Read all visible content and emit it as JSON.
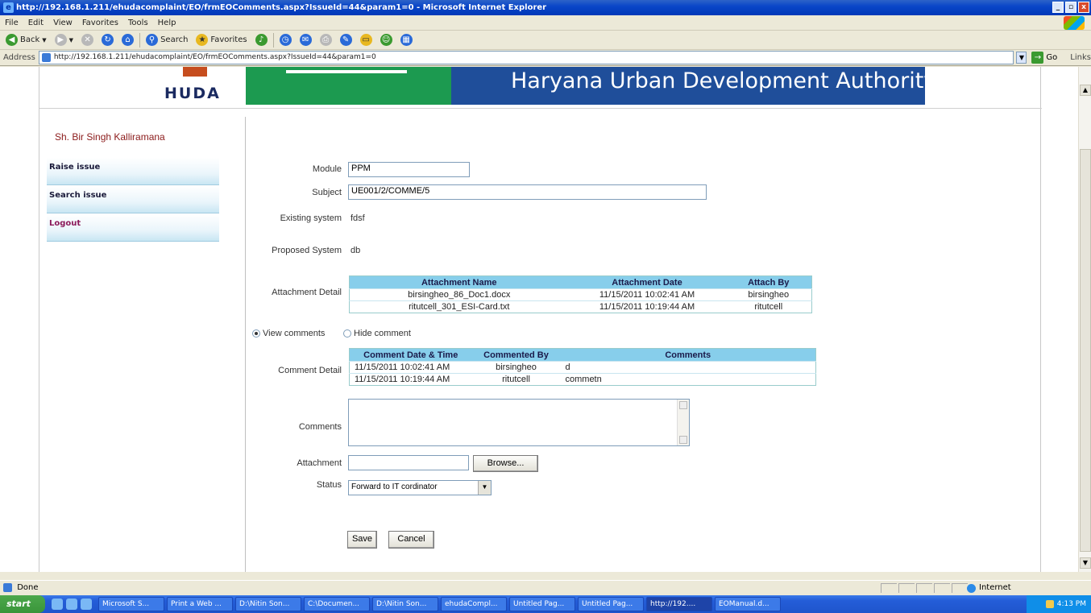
{
  "window": {
    "title": "http://192.168.1.211/ehudacomplaint/EO/frmEOComments.aspx?IssueId=44&param1=0 - Microsoft Internet Explorer",
    "controls": [
      "_",
      "▫",
      "x"
    ]
  },
  "menu": [
    "File",
    "Edit",
    "View",
    "Favorites",
    "Tools",
    "Help"
  ],
  "toolbar": {
    "back_label": "Back",
    "search_label": "Search",
    "favorites_label": "Favorites"
  },
  "addressbar": {
    "label": "Address",
    "url": "http://192.168.1.211/ehudacomplaint/EO/frmEOComments.aspx?IssueId=44&param1=0",
    "go_label": "Go",
    "links_label": "Links"
  },
  "banner": {
    "logo_text": "HUDA",
    "org_name": "Haryana Urban Development Authority"
  },
  "sidebar": {
    "user_name": "Sh. Bir Singh Kalliramana",
    "items": [
      {
        "label": "Raise issue"
      },
      {
        "label": "Search issue"
      },
      {
        "label": "Logout"
      }
    ]
  },
  "form": {
    "module_label": "Module",
    "module_value": "PPM",
    "subject_label": "Subject",
    "subject_value": "UE001/2/COMME/5",
    "existing_label": "Existing system",
    "existing_value": "fdsf",
    "proposed_label": "Proposed System",
    "proposed_value": "db",
    "attachment_detail_label": "Attachment Detail",
    "view_comments_label": "View comments",
    "hide_comment_label": "Hide comment",
    "comment_detail_label": "Comment Detail",
    "comments_label": "Comments",
    "comments_value": "",
    "attachment_label": "Attachment",
    "attachment_value": "",
    "browse_label": "Browse...",
    "status_label": "Status",
    "status_value": "Forward to IT cordinator",
    "save_label": "Save",
    "cancel_label": "Cancel"
  },
  "attachments": {
    "headers": [
      "Attachment Name",
      "Attachment Date",
      "Attach By"
    ],
    "rows": [
      [
        "birsingheo_86_Doc1.docx",
        "11/15/2011 10:02:41 AM",
        "birsingheo"
      ],
      [
        "ritutcell_301_ESI-Card.txt",
        "11/15/2011 10:19:44 AM",
        "ritutcell"
      ]
    ]
  },
  "comments": {
    "headers": [
      "Comment Date & Time",
      "Commented By",
      "Comments"
    ],
    "rows": [
      [
        "11/15/2011 10:02:41 AM",
        "birsingheo",
        "d"
      ],
      [
        "11/15/2011 10:19:44 AM",
        "ritutcell",
        "commetn"
      ]
    ]
  },
  "statusbar": {
    "status_text": "Done",
    "zone": "Internet"
  },
  "taskbar": {
    "start_label": "start",
    "tasks": [
      "Microsoft S...",
      "Print a Web ...",
      "D:\\Nitin Son...",
      "C:\\Documen...",
      "D:\\Nitin Son...",
      "ehudaCompl...",
      "Untitled Pag...",
      "Untitled Pag...",
      "http://192....",
      "EOManual.d..."
    ],
    "clock": "4:13 PM"
  },
  "colors": {
    "title_bar": "#0a46c8",
    "banner_green": "#1c9a50",
    "banner_blue": "#1f4e9a",
    "grid_header": "#87ceeb",
    "user_name": "#8b1a1a"
  }
}
